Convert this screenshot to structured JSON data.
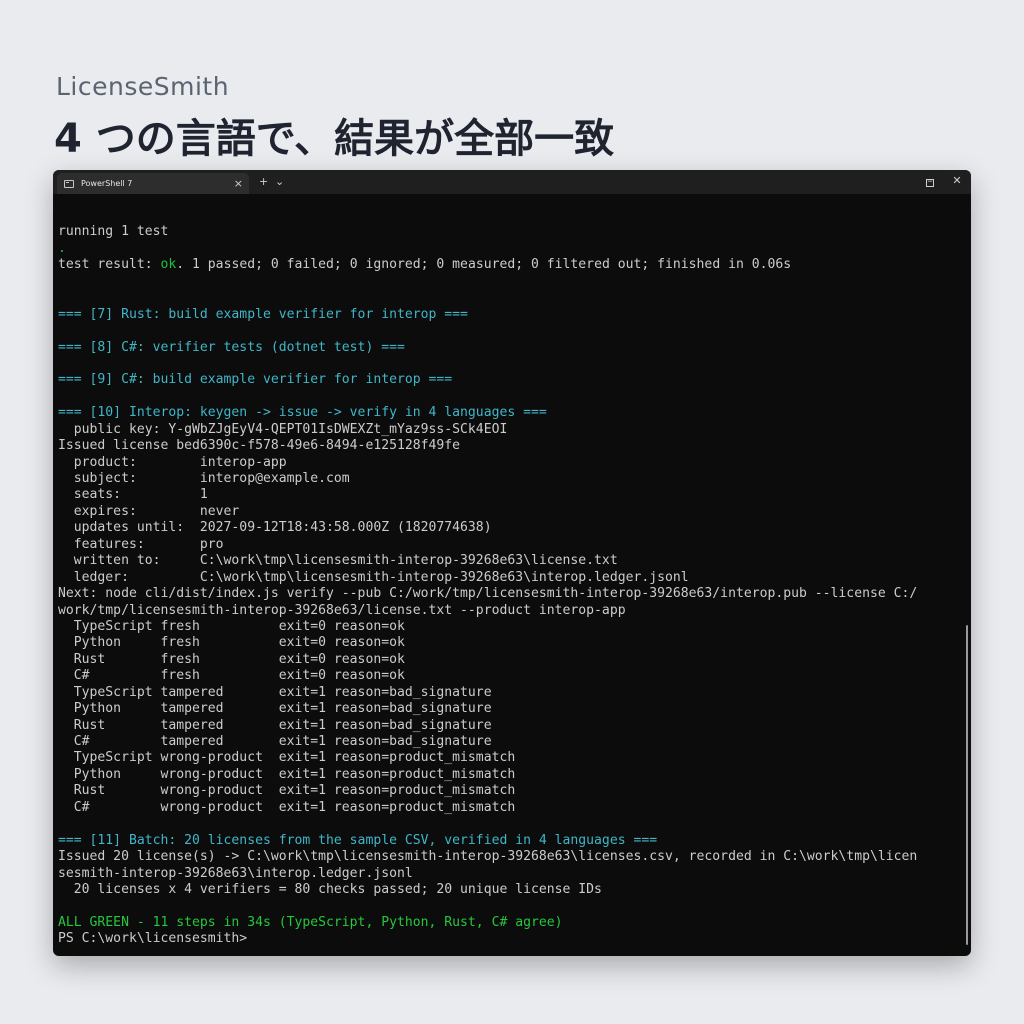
{
  "header": {
    "brand": "LicenseSmith",
    "headline": "4 つの言語で、結果が全部一致"
  },
  "window": {
    "tab_title": "PowerShell 7",
    "tab_icon": "terminal-icon",
    "tab_close": "×",
    "new_tab": "+",
    "dropdown": "⌄",
    "minimize": "–",
    "close": "✕"
  },
  "colors": {
    "page_bg": "#e9ebef",
    "terminal_bg": "#0c0c0c",
    "section": "#3fb6c9",
    "ok": "#22c23a",
    "text": "#cccccc"
  },
  "terminal": {
    "lines": [
      {
        "text": "",
        "style": ""
      },
      {
        "text": "running 1 test",
        "style": ""
      },
      {
        "text": ".",
        "style": "c-ok"
      },
      {
        "text": "test result: ok. 1 passed; 0 failed; 0 ignored; 0 measured; 0 filtered out; finished in 0.06s",
        "style": "",
        "prefix": "test result: ",
        "highlight": "ok",
        "suffix": ". 1 passed; 0 failed; 0 ignored; 0 measured; 0 filtered out; finished in 0.06s"
      },
      {
        "text": "",
        "style": ""
      },
      {
        "text": "",
        "style": ""
      },
      {
        "text": "=== [7] Rust: build example verifier for interop ===",
        "style": "c-section"
      },
      {
        "text": "",
        "style": ""
      },
      {
        "text": "=== [8] C#: verifier tests (dotnet test) ===",
        "style": "c-section"
      },
      {
        "text": "",
        "style": ""
      },
      {
        "text": "=== [9] C#: build example verifier for interop ===",
        "style": "c-section"
      },
      {
        "text": "",
        "style": ""
      },
      {
        "text": "=== [10] Interop: keygen -> issue -> verify in 4 languages ===",
        "style": "c-section"
      },
      {
        "text": "  public key: Y-gWbZJgEyV4-QEPT01IsDWEXZt_mYaz9ss-SCk4EOI",
        "style": ""
      },
      {
        "text": "Issued license bed6390c-f578-49e6-8494-e125128f49fe",
        "style": ""
      },
      {
        "text": "  product:        interop-app",
        "style": ""
      },
      {
        "text": "  subject:        interop@example.com",
        "style": ""
      },
      {
        "text": "  seats:          1",
        "style": ""
      },
      {
        "text": "  expires:        never",
        "style": ""
      },
      {
        "text": "  updates until:  2027-09-12T18:43:58.000Z (1820774638)",
        "style": ""
      },
      {
        "text": "  features:       pro",
        "style": ""
      },
      {
        "text": "  written to:     C:\\work\\tmp\\licensesmith-interop-39268e63\\license.txt",
        "style": ""
      },
      {
        "text": "  ledger:         C:\\work\\tmp\\licensesmith-interop-39268e63\\interop.ledger.jsonl",
        "style": ""
      },
      {
        "text": "Next: node cli/dist/index.js verify --pub C:/work/tmp/licensesmith-interop-39268e63/interop.pub --license C:/",
        "style": ""
      },
      {
        "text": "work/tmp/licensesmith-interop-39268e63/license.txt --product interop-app",
        "style": ""
      },
      {
        "text": "  TypeScript fresh          exit=0 reason=ok",
        "style": ""
      },
      {
        "text": "  Python     fresh          exit=0 reason=ok",
        "style": ""
      },
      {
        "text": "  Rust       fresh          exit=0 reason=ok",
        "style": ""
      },
      {
        "text": "  C#         fresh          exit=0 reason=ok",
        "style": ""
      },
      {
        "text": "  TypeScript tampered       exit=1 reason=bad_signature",
        "style": ""
      },
      {
        "text": "  Python     tampered       exit=1 reason=bad_signature",
        "style": ""
      },
      {
        "text": "  Rust       tampered       exit=1 reason=bad_signature",
        "style": ""
      },
      {
        "text": "  C#         tampered       exit=1 reason=bad_signature",
        "style": ""
      },
      {
        "text": "  TypeScript wrong-product  exit=1 reason=product_mismatch",
        "style": ""
      },
      {
        "text": "  Python     wrong-product  exit=1 reason=product_mismatch",
        "style": ""
      },
      {
        "text": "  Rust       wrong-product  exit=1 reason=product_mismatch",
        "style": ""
      },
      {
        "text": "  C#         wrong-product  exit=1 reason=product_mismatch",
        "style": ""
      },
      {
        "text": "",
        "style": ""
      },
      {
        "text": "=== [11] Batch: 20 licenses from the sample CSV, verified in 4 languages ===",
        "style": "c-section"
      },
      {
        "text": "Issued 20 license(s) -> C:\\work\\tmp\\licensesmith-interop-39268e63\\licenses.csv, recorded in C:\\work\\tmp\\licen",
        "style": ""
      },
      {
        "text": "sesmith-interop-39268e63\\interop.ledger.jsonl",
        "style": ""
      },
      {
        "text": "  20 licenses x 4 verifiers = 80 checks passed; 20 unique license IDs",
        "style": ""
      },
      {
        "text": "",
        "style": ""
      },
      {
        "text": "ALL GREEN - 11 steps in 34s (TypeScript, Python, Rust, C# agree)",
        "style": "c-green"
      },
      {
        "text": "PS C:\\work\\licensesmith>",
        "style": ""
      }
    ]
  }
}
